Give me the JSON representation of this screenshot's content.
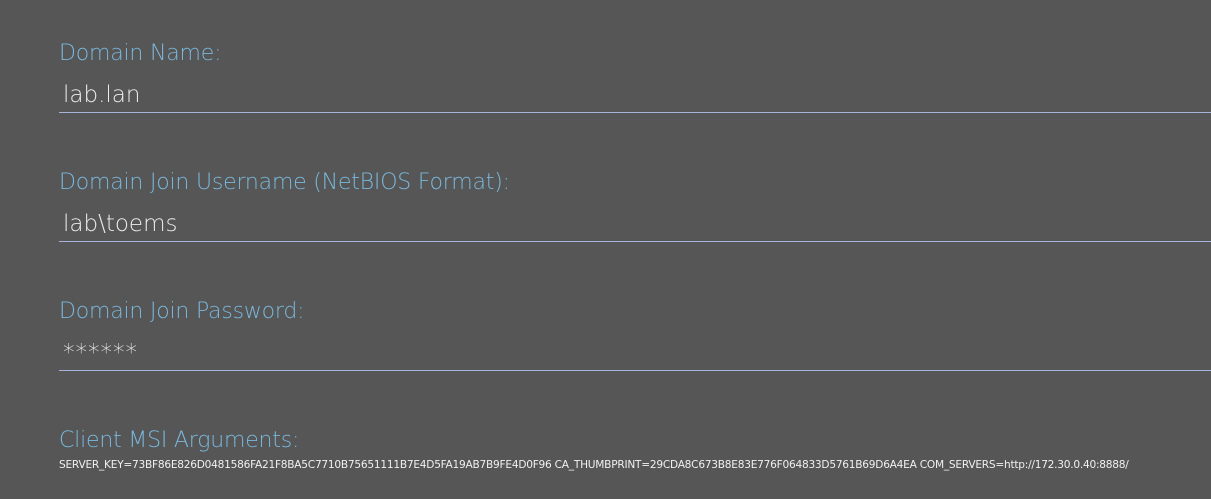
{
  "form": {
    "domain_name": {
      "label": "Domain Name:",
      "value": "lab.lan"
    },
    "domain_join_username": {
      "label": "Domain Join Username (NetBIOS Format):",
      "value": "lab\\toems"
    },
    "domain_join_password": {
      "label": "Domain Join Password:",
      "value": "******"
    },
    "client_msi_arguments": {
      "label": "Client MSI Arguments:",
      "value": "SERVER_KEY=73BF86E826D0481586FA21F8BA5C7710B75651111B7E4D5FA19AB7B9FE4D0F96 CA_THUMBPRINT=29CDA8C673B8E83E776F064833D5761B69D6A4EA COM_SERVERS=http://172.30.0.40:8888/"
    }
  },
  "colors": {
    "background": "#565656",
    "label": "#7ab8dc",
    "input_text": "#ececec",
    "underline": "#a9b4dc"
  }
}
